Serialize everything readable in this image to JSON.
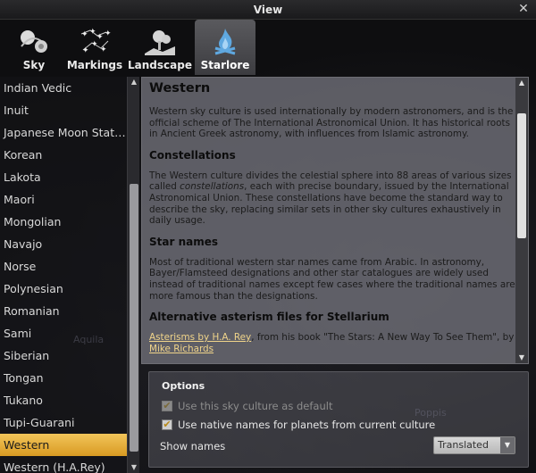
{
  "window": {
    "title": "View"
  },
  "tabs": [
    {
      "label": "Sky",
      "icon": "sky-icon"
    },
    {
      "label": "Markings",
      "icon": "markings-icon"
    },
    {
      "label": "Landscape",
      "icon": "landscape-icon"
    },
    {
      "label": "Starlore",
      "icon": "starlore-icon",
      "active": true
    }
  ],
  "cultures": [
    "Indian Vedic",
    "Inuit",
    "Japanese Moon Stati…",
    "Korean",
    "Lakota",
    "Maori",
    "Mongolian",
    "Navajo",
    "Norse",
    "Polynesian",
    "Romanian",
    "Sami",
    "Siberian",
    "Tongan",
    "Tukano",
    "Tupi-Guarani",
    "Western",
    "Western (H.A.Rey)"
  ],
  "selected_culture": "Western",
  "description": {
    "title": "Western",
    "intro": "Western sky culture is used internationally by modern astronomers, and is the official scheme of The International Astronomical Union. It has historical roots in Ancient Greek astronomy, with influences from Islamic astronomy.",
    "constellations_heading": "Constellations",
    "constellations_text_1": "The Western culture divides the celestial sphere into 88 areas of various sizes called ",
    "constellations_text_em": "constellations",
    "constellations_text_2": ", each with precise boundary, issued by the International Astronomical Union. These constellations have become the standard way to describe the sky, replacing similar sets in other sky cultures exhaustively in daily usage.",
    "starnames_heading": "Star names",
    "starnames_text": "Most of traditional western star names came from Arabic. In astronomy, Bayer/Flamsteed designations and other star catalogues are widely used instead of traditional names except few cases where the traditional names are more famous than the designations.",
    "asterism_heading": "Alternative asterism files for Stellarium",
    "asterism_link_1": "Asterisms by H.A. Rey",
    "asterism_text": ", from his book \"The Stars: A New Way To See Them\", by ",
    "asterism_link_2": "Mike Richards"
  },
  "options": {
    "title": "Options",
    "use_default_label": "Use this sky culture as default",
    "use_default_checked": true,
    "native_names_label": "Use native names for planets from current culture",
    "native_names_checked": true,
    "show_names_label": "Show names",
    "show_names_value": "Translated"
  },
  "background_labels": {
    "a": "Aquila",
    "b": "Poppis"
  },
  "colors": {
    "accent": "#e8b33e",
    "link": "#f0d48a"
  }
}
